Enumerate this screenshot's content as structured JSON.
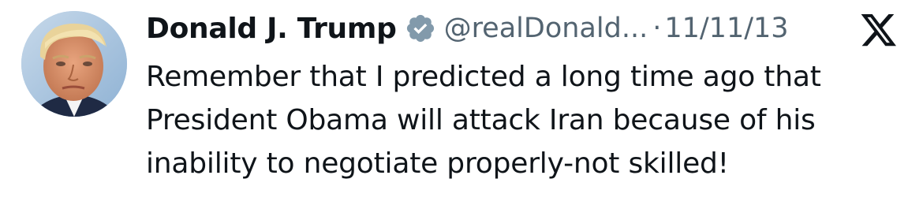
{
  "author": {
    "name": "Donald J. Trump",
    "handle": "@realDonald...",
    "verified": true,
    "avatar": "profile-photo"
  },
  "meta": {
    "separator": "·",
    "date": "11/11/13"
  },
  "platform": {
    "logo": "x-logo-icon"
  },
  "tweet": {
    "lines": [
      "Remember that I predicted a long time ago that",
      "President Obama will attack Iran because of his",
      "inability to negotiate properly-not skilled!"
    ]
  },
  "colors": {
    "text": "#0f1419",
    "secondary": "#536471",
    "verified_badge": "#829aab"
  }
}
